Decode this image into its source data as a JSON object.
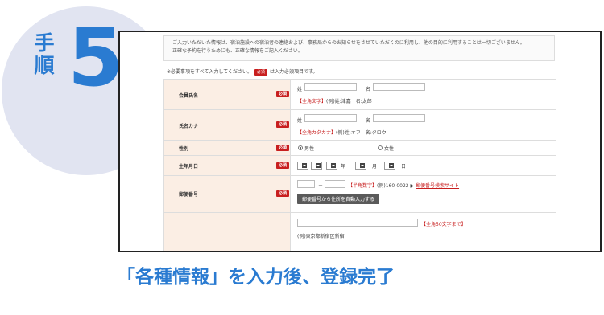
{
  "step": {
    "kanji": "手順",
    "number": "5"
  },
  "caption": "「各種情報」を入力後、登録完了",
  "colors": {
    "accent_blue": "#2a7bd1",
    "required_red": "#c81f1f",
    "label_bg": "#fbeee4",
    "circle_bg": "#e1e4f1"
  },
  "form": {
    "notice_line1": "ご入力いただいた情報は、宿泊施設への宿泊者の連絡および、事務局からのお知らせをさせていただくのに利用し、他の目的に利用することは一切ございません。",
    "notice_line2": "正確な予約を行うためにも、正確な情報をご記入ください。",
    "required_note_prefix": "※必要事項をすべて入力してください。",
    "required_tag": "必須",
    "required_note_suffix": "は入力必須項目です。",
    "rows": {
      "member_name": {
        "label": "会員氏名",
        "sei": "姓",
        "mei": "名",
        "hint_red": "【全角文字】",
        "hint": "(例)姓:津嘉　名:太郎"
      },
      "kana": {
        "label": "氏名カナ",
        "sei": "姓",
        "mei": "名",
        "hint_red": "【全角カタカナ】",
        "hint": "(例)姓:オフ　名:タロウ"
      },
      "gender": {
        "label": "性別",
        "male": "男性",
        "female": "女性"
      },
      "birthday": {
        "label": "生年月日",
        "year": "年",
        "month": "月",
        "day": "日"
      },
      "postal": {
        "label": "郵便番号",
        "dash": "－",
        "hint_red": "【半角数字】",
        "hint": "(例)160-0022",
        "link": "郵便番号検索サイト",
        "auto_button": "郵便番号から住所を自動入力する"
      },
      "address": {
        "hint_red": "【全角50文字まで】",
        "example": "(例)東京都新宿区新宿"
      }
    }
  }
}
